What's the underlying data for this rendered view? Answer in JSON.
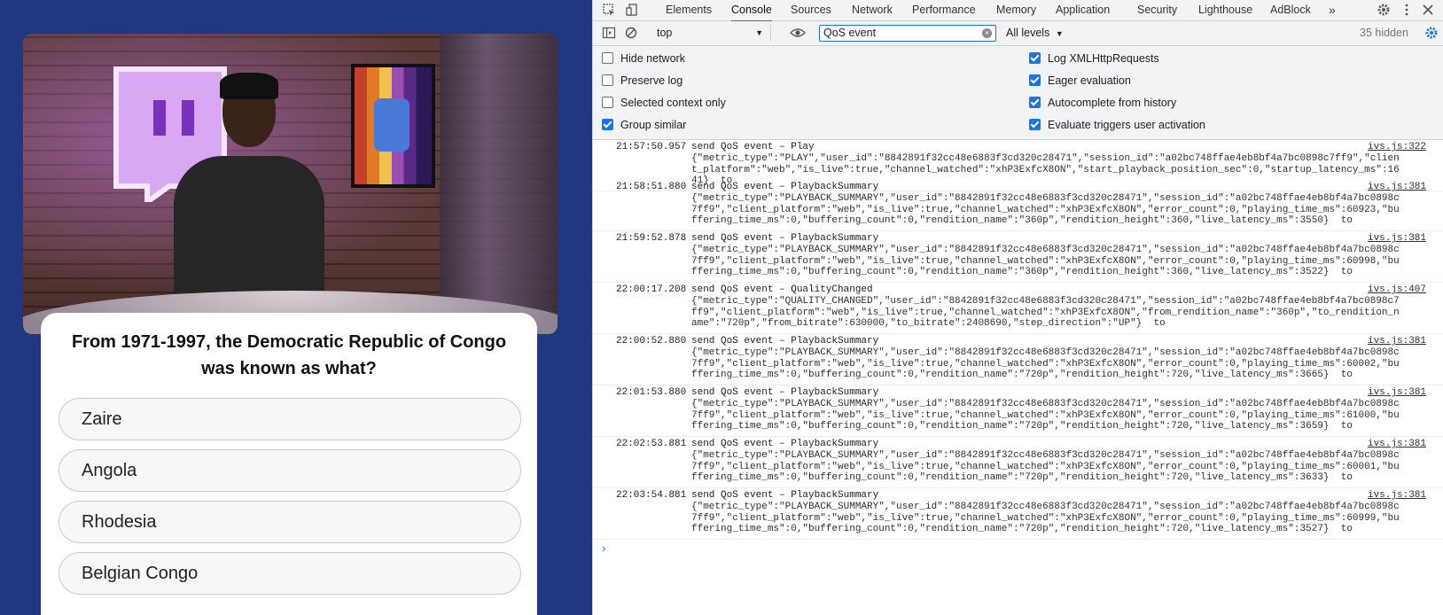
{
  "quiz": {
    "question": "From 1971-1997, the Democratic Republic of Congo was known as what?",
    "options": [
      "Zaire",
      "Angola",
      "Rhodesia",
      "Belgian Congo"
    ]
  },
  "devtools": {
    "tabs": [
      "Elements",
      "Console",
      "Sources",
      "Network",
      "Performance",
      "Memory",
      "Application",
      "Security",
      "Lighthouse",
      "AdBlock"
    ],
    "active_tab": "Console",
    "more_tabs": "»",
    "context": "top",
    "filter_value": "QoS event",
    "levels": "All levels",
    "hidden": "35 hidden",
    "settings_left": [
      "Hide network",
      "Preserve log",
      "Selected context only",
      "Group similar"
    ],
    "settings_left_checked": [
      false,
      false,
      false,
      true
    ],
    "settings_right": [
      "Log XMLHttpRequests",
      "Eager evaluation",
      "Autocomplete from history",
      "Evaluate triggers user activation"
    ],
    "settings_right_checked": [
      true,
      true,
      true,
      true
    ],
    "prompt": "›",
    "logs": [
      {
        "time": "21:57:50.957",
        "msg": "send QoS event – Play",
        "json": "{\"metric_type\":\"PLAY\",\"user_id\":\"8842891f32cc48e6883f3cd320c28471\",\"session_id\":\"a02bc748ffae4eb8bf4a7bc0898c7ff9\",\"client_platform\":\"web\",\"is_live\":true,\"channel_watched\":\"xhP3ExfcX8ON\",\"start_playback_position_sec\":0,\"startup_latency_ms\":1641}  to",
        "src": "ivs.js:322"
      },
      {
        "time": "21:58:51.880",
        "msg": "send QoS event – PlaybackSummary",
        "json": "{\"metric_type\":\"PLAYBACK_SUMMARY\",\"user_id\":\"8842891f32cc48e6883f3cd320c28471\",\"session_id\":\"a02bc748ffae4eb8bf4a7bc0898c7ff9\",\"client_platform\":\"web\",\"is_live\":true,\"channel_watched\":\"xhP3ExfcX8ON\",\"error_count\":0,\"playing_time_ms\":60923,\"buffering_time_ms\":0,\"buffering_count\":0,\"rendition_name\":\"360p\",\"rendition_height\":360,\"live_latency_ms\":3550}  to",
        "src": "ivs.js:381"
      },
      {
        "time": "21:59:52.878",
        "msg": "send QoS event – PlaybackSummary",
        "json": "{\"metric_type\":\"PLAYBACK_SUMMARY\",\"user_id\":\"8842891f32cc48e6883f3cd320c28471\",\"session_id\":\"a02bc748ffae4eb8bf4a7bc0898c7ff9\",\"client_platform\":\"web\",\"is_live\":true,\"channel_watched\":\"xhP3ExfcX8ON\",\"error_count\":0,\"playing_time_ms\":60998,\"buffering_time_ms\":0,\"buffering_count\":0,\"rendition_name\":\"360p\",\"rendition_height\":360,\"live_latency_ms\":3522}  to",
        "src": "ivs.js:381"
      },
      {
        "time": "22:00:17.208",
        "msg": "send QoS event – QualityChanged",
        "json": "{\"metric_type\":\"QUALITY_CHANGED\",\"user_id\":\"8842891f32cc48e6883f3cd320c28471\",\"session_id\":\"a02bc748ffae4eb8bf4a7bc0898c7ff9\",\"client_platform\":\"web\",\"is_live\":true,\"channel_watched\":\"xhP3ExfcX8ON\",\"from_rendition_name\":\"360p\",\"to_rendition_name\":\"720p\",\"from_bitrate\":630000,\"to_bitrate\":2408690,\"step_direction\":\"UP\"}  to",
        "src": "ivs.js:407"
      },
      {
        "time": "22:00:52.880",
        "msg": "send QoS event – PlaybackSummary",
        "json": "{\"metric_type\":\"PLAYBACK_SUMMARY\",\"user_id\":\"8842891f32cc48e6883f3cd320c28471\",\"session_id\":\"a02bc748ffae4eb8bf4a7bc0898c7ff9\",\"client_platform\":\"web\",\"is_live\":true,\"channel_watched\":\"xhP3ExfcX8ON\",\"error_count\":0,\"playing_time_ms\":60002,\"buffering_time_ms\":0,\"buffering_count\":0,\"rendition_name\":\"720p\",\"rendition_height\":720,\"live_latency_ms\":3665}  to",
        "src": "ivs.js:381"
      },
      {
        "time": "22:01:53.880",
        "msg": "send QoS event – PlaybackSummary",
        "json": "{\"metric_type\":\"PLAYBACK_SUMMARY\",\"user_id\":\"8842891f32cc48e6883f3cd320c28471\",\"session_id\":\"a02bc748ffae4eb8bf4a7bc0898c7ff9\",\"client_platform\":\"web\",\"is_live\":true,\"channel_watched\":\"xhP3ExfcX8ON\",\"error_count\":0,\"playing_time_ms\":61000,\"buffering_time_ms\":0,\"buffering_count\":0,\"rendition_name\":\"720p\",\"rendition_height\":720,\"live_latency_ms\":3659}  to",
        "src": "ivs.js:381"
      },
      {
        "time": "22:02:53.881",
        "msg": "send QoS event – PlaybackSummary",
        "json": "{\"metric_type\":\"PLAYBACK_SUMMARY\",\"user_id\":\"8842891f32cc48e6883f3cd320c28471\",\"session_id\":\"a02bc748ffae4eb8bf4a7bc0898c7ff9\",\"client_platform\":\"web\",\"is_live\":true,\"channel_watched\":\"xhP3ExfcX8ON\",\"error_count\":0,\"playing_time_ms\":60001,\"buffering_time_ms\":0,\"buffering_count\":0,\"rendition_name\":\"720p\",\"rendition_height\":720,\"live_latency_ms\":3633}  to",
        "src": "ivs.js:381"
      },
      {
        "time": "22:03:54.881",
        "msg": "send QoS event – PlaybackSummary",
        "json": "{\"metric_type\":\"PLAYBACK_SUMMARY\",\"user_id\":\"8842891f32cc48e6883f3cd320c28471\",\"session_id\":\"a02bc748ffae4eb8bf4a7bc0898c7ff9\",\"client_platform\":\"web\",\"is_live\":true,\"channel_watched\":\"xhP3ExfcX8ON\",\"error_count\":0,\"playing_time_ms\":60999,\"buffering_time_ms\":0,\"buffering_count\":0,\"rendition_name\":\"720p\",\"rendition_height\":720,\"live_latency_ms\":3527}  to",
        "src": "ivs.js:381"
      }
    ]
  },
  "colors": {
    "page_bg": "#213781",
    "accent": "#1a73e8",
    "twitch_purple": "#9146ff"
  }
}
